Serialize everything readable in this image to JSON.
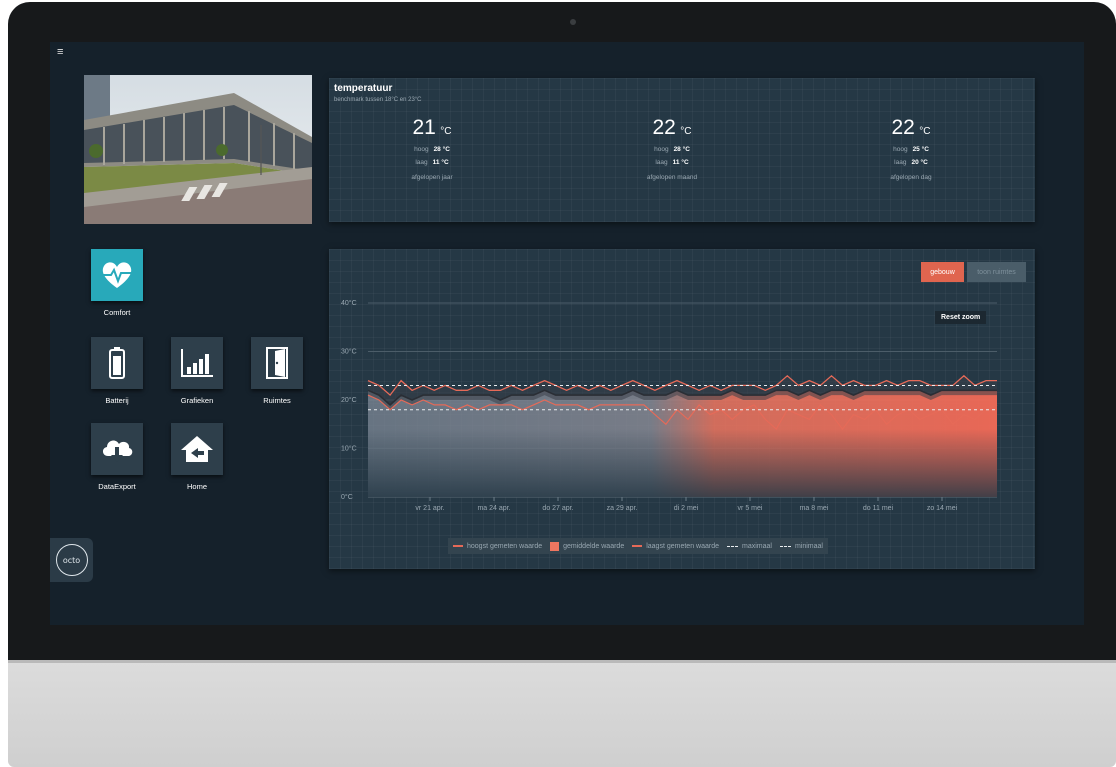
{
  "screen": {
    "menu_icon": "hamburger-icon"
  },
  "temperature": {
    "title": "temperatuur",
    "subtitle": "benchmark tussen 18°C en 23°C",
    "unit": "°C",
    "columns": [
      {
        "value": "21",
        "hoog_label": "hoog",
        "hoog": "28",
        "laag_label": "laag",
        "laag": "11",
        "period_prefix": "afgelopen",
        "period": "jaar"
      },
      {
        "value": "22",
        "hoog_label": "hoog",
        "hoog": "28",
        "laag_label": "laag",
        "laag": "11",
        "period_prefix": "afgelopen",
        "period": "maand"
      },
      {
        "value": "22",
        "hoog_label": "hoog",
        "hoog": "25",
        "laag_label": "laag",
        "laag": "20",
        "period_prefix": "afgelopen",
        "period": "dag"
      }
    ]
  },
  "tiles": [
    {
      "label": "Comfort",
      "icon": "heart-pulse-icon"
    },
    {
      "label": "Batterij",
      "icon": "battery-icon"
    },
    {
      "label": "Grafieken",
      "icon": "bar-chart-icon"
    },
    {
      "label": "Ruimtes",
      "icon": "door-icon"
    },
    {
      "label": "DataExport",
      "icon": "cloud-download-icon"
    },
    {
      "label": "Home",
      "icon": "home-icon"
    }
  ],
  "logo": {
    "text": "octo"
  },
  "chart_controls": {
    "gebouw": "gebouw",
    "toon_ruimtes": "toon ruimtes",
    "reset_zoom": "Reset zoom"
  },
  "colors": {
    "accent": "#e0654f",
    "tile_teal": "#28a9ba",
    "panel": "#253845",
    "screen_bg": "#15212b"
  },
  "chart_data": {
    "type": "area",
    "ylim": [
      0,
      40
    ],
    "y_ticks": [
      "0°C",
      "10°C",
      "20°C",
      "30°C",
      "40°C"
    ],
    "x_ticks": [
      "vr 21 apr.",
      "ma 24 apr.",
      "do 27 apr.",
      "za 29 apr.",
      "di 2 mei",
      "vr 5 mei",
      "ma 8 mei",
      "do 11 mei",
      "zo 14 mei"
    ],
    "grid": true,
    "legend_position": "bottom",
    "reference_lines": {
      "maximaal": 23,
      "minimaal": 18
    },
    "series": [
      {
        "name": "hoogst gemeten waarde",
        "style": "line",
        "color": "#e66a58",
        "values": [
          24,
          23,
          21,
          24,
          22,
          23,
          22,
          23,
          22,
          22,
          23,
          22,
          22,
          23,
          22,
          23,
          24,
          23,
          22,
          23,
          22,
          23,
          22,
          23,
          24,
          23,
          22,
          23,
          24,
          23,
          22,
          23,
          22,
          23,
          23,
          23,
          22,
          23,
          25,
          23,
          24,
          23,
          25,
          23,
          24,
          23,
          23,
          24,
          23,
          24,
          24,
          23,
          23,
          23,
          25,
          23,
          24,
          24
        ]
      },
      {
        "name": "gemiddelde waarde",
        "style": "area",
        "color": "#ef7660",
        "values": [
          22,
          21,
          19,
          21,
          20,
          21,
          21,
          21,
          21,
          21,
          21,
          21,
          20,
          21,
          21,
          21,
          22,
          21,
          21,
          21,
          21,
          21,
          21,
          21,
          22,
          21,
          21,
          21,
          22,
          21,
          21,
          21,
          21,
          22,
          21,
          21,
          21,
          22,
          22,
          21,
          22,
          21,
          22,
          22,
          21,
          22,
          22,
          22,
          22,
          22,
          22,
          21,
          22,
          22,
          22,
          22,
          22,
          22
        ]
      },
      {
        "name": "laagst gemeten waarde",
        "style": "line",
        "color": "#e66a58",
        "values": [
          21,
          20,
          18,
          20,
          19,
          20,
          19,
          19,
          18,
          19,
          18,
          19,
          19,
          19,
          18,
          19,
          20,
          19,
          19,
          19,
          18,
          19,
          19,
          19,
          19,
          19,
          17,
          15,
          18,
          16,
          19,
          17,
          18,
          16,
          18,
          19,
          16,
          14,
          18,
          17,
          16,
          19,
          17,
          14,
          17,
          16,
          18,
          15,
          17,
          18,
          16,
          17,
          18,
          15,
          17,
          16,
          18,
          19
        ]
      },
      {
        "name": "maximaal",
        "style": "dashed",
        "color": "#e9edf0",
        "values": [
          23
        ]
      },
      {
        "name": "minimaal",
        "style": "dashed",
        "color": "#e9edf0",
        "values": [
          18
        ]
      }
    ]
  }
}
